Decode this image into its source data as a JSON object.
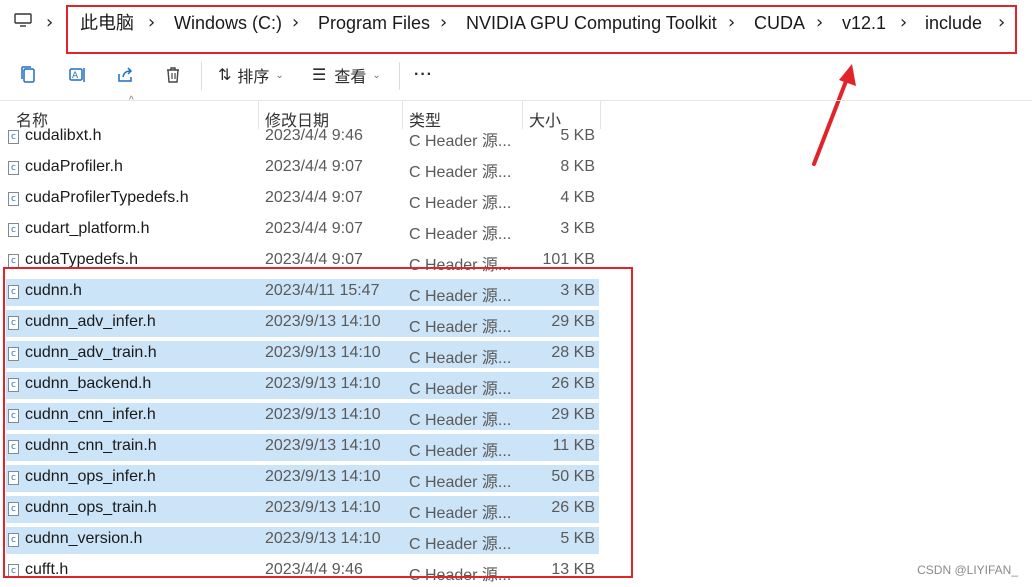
{
  "breadcrumb": {
    "items": [
      "此电脑",
      "Windows (C:)",
      "Program Files",
      "NVIDIA GPU Computing Toolkit",
      "CUDA",
      "v12.1",
      "include"
    ]
  },
  "toolbar": {
    "sort_label": "排序",
    "view_label": "查看",
    "more_label": "···"
  },
  "columns": {
    "name": "名称",
    "modified": "修改日期",
    "type": "类型",
    "size": "大小"
  },
  "files": [
    {
      "name": "cudalibxt.h",
      "modified": "2023/4/4 9:46",
      "type": "C Header 源...",
      "size": "5 KB",
      "selected": false
    },
    {
      "name": "cudaProfiler.h",
      "modified": "2023/4/4 9:07",
      "type": "C Header 源...",
      "size": "8 KB",
      "selected": false
    },
    {
      "name": "cudaProfilerTypedefs.h",
      "modified": "2023/4/4 9:07",
      "type": "C Header 源...",
      "size": "4 KB",
      "selected": false
    },
    {
      "name": "cudart_platform.h",
      "modified": "2023/4/4 9:07",
      "type": "C Header 源...",
      "size": "3 KB",
      "selected": false
    },
    {
      "name": "cudaTypedefs.h",
      "modified": "2023/4/4 9:07",
      "type": "C Header 源...",
      "size": "101 KB",
      "selected": false
    },
    {
      "name": "cudnn.h",
      "modified": "2023/4/11 15:47",
      "type": "C Header 源...",
      "size": "3 KB",
      "selected": true
    },
    {
      "name": "cudnn_adv_infer.h",
      "modified": "2023/9/13 14:10",
      "type": "C Header 源...",
      "size": "29 KB",
      "selected": true
    },
    {
      "name": "cudnn_adv_train.h",
      "modified": "2023/9/13 14:10",
      "type": "C Header 源...",
      "size": "28 KB",
      "selected": true
    },
    {
      "name": "cudnn_backend.h",
      "modified": "2023/9/13 14:10",
      "type": "C Header 源...",
      "size": "26 KB",
      "selected": true
    },
    {
      "name": "cudnn_cnn_infer.h",
      "modified": "2023/9/13 14:10",
      "type": "C Header 源...",
      "size": "29 KB",
      "selected": true
    },
    {
      "name": "cudnn_cnn_train.h",
      "modified": "2023/9/13 14:10",
      "type": "C Header 源...",
      "size": "11 KB",
      "selected": true
    },
    {
      "name": "cudnn_ops_infer.h",
      "modified": "2023/9/13 14:10",
      "type": "C Header 源...",
      "size": "50 KB",
      "selected": true
    },
    {
      "name": "cudnn_ops_train.h",
      "modified": "2023/9/13 14:10",
      "type": "C Header 源...",
      "size": "26 KB",
      "selected": true
    },
    {
      "name": "cudnn_version.h",
      "modified": "2023/9/13 14:10",
      "type": "C Header 源...",
      "size": "5 KB",
      "selected": true
    },
    {
      "name": "cufft.h",
      "modified": "2023/4/4 9:46",
      "type": "C Header 源...",
      "size": "13 KB",
      "selected": false
    }
  ],
  "watermark": "CSDN @LIYIFAN_",
  "colors": {
    "selection": "#cce4f7",
    "annotation": "#e0242a"
  }
}
